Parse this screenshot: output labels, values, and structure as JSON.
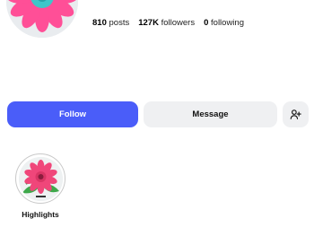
{
  "profile": {
    "avatar_icon": "flower-avatar-icon",
    "stats": {
      "posts": {
        "value": "810",
        "label": "posts"
      },
      "followers": {
        "value": "127K",
        "label": "followers"
      },
      "following": {
        "value": "0",
        "label": "following"
      }
    }
  },
  "actions": {
    "follow_label": "Follow",
    "message_label": "Message",
    "suggest_icon": "add-person-icon"
  },
  "highlights": [
    {
      "label": "Highlights",
      "icon": "pink-flower-icon"
    }
  ],
  "colors": {
    "follow_bg": "#4a5df9",
    "secondary_bg": "#eff0f2",
    "flower_pink": "#f0467a",
    "flower_teal": "#3ec6c9"
  }
}
